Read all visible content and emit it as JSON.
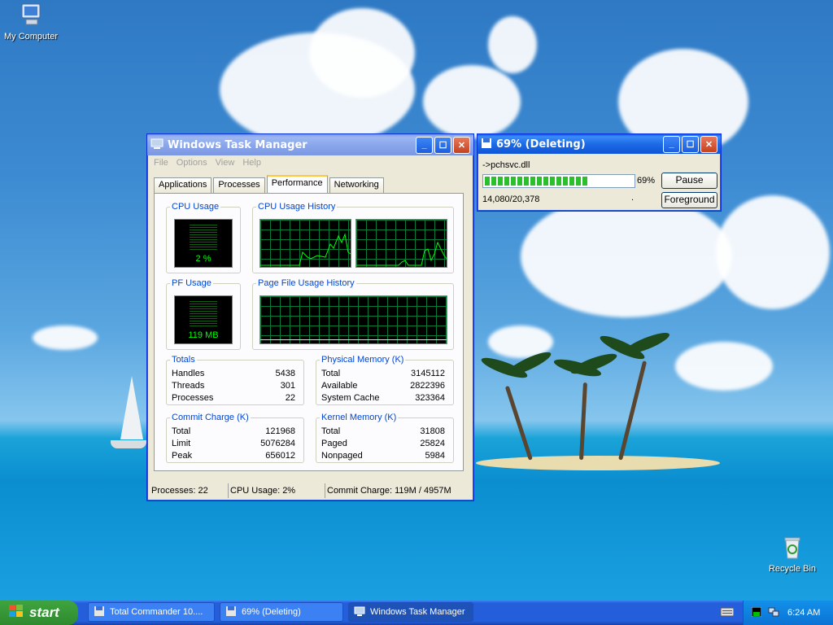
{
  "desktop": {
    "icons": [
      {
        "label": "My Computer"
      },
      {
        "label": "Recycle Bin"
      }
    ]
  },
  "task_manager": {
    "title": "Windows Task Manager",
    "menu": [
      "File",
      "Options",
      "View",
      "Help"
    ],
    "tabs": [
      "Applications",
      "Processes",
      "Performance",
      "Networking"
    ],
    "active_tab": "Performance",
    "cpu_usage": {
      "label": "CPU Usage",
      "value_text": "2 %"
    },
    "cpu_history": {
      "label": "CPU Usage History"
    },
    "pf_usage": {
      "label": "PF Usage",
      "value_text": "119 MB"
    },
    "pf_history": {
      "label": "Page File Usage History"
    },
    "totals": {
      "label": "Totals",
      "rows": [
        {
          "k": "Handles",
          "v": "5438"
        },
        {
          "k": "Threads",
          "v": "301"
        },
        {
          "k": "Processes",
          "v": "22"
        }
      ]
    },
    "physical_memory": {
      "label": "Physical Memory (K)",
      "rows": [
        {
          "k": "Total",
          "v": "3145112"
        },
        {
          "k": "Available",
          "v": "2822396"
        },
        {
          "k": "System Cache",
          "v": "323364"
        }
      ]
    },
    "commit_charge": {
      "label": "Commit Charge (K)",
      "rows": [
        {
          "k": "Total",
          "v": "121968"
        },
        {
          "k": "Limit",
          "v": "5076284"
        },
        {
          "k": "Peak",
          "v": "656012"
        }
      ]
    },
    "kernel_memory": {
      "label": "Kernel Memory (K)",
      "rows": [
        {
          "k": "Total",
          "v": "31808"
        },
        {
          "k": "Paged",
          "v": "25824"
        },
        {
          "k": "Nonpaged",
          "v": "5984"
        }
      ]
    },
    "status": {
      "processes": "Processes: 22",
      "cpu": "CPU Usage: 2%",
      "commit": "Commit Charge: 119M / 4957M"
    }
  },
  "delete_dialog": {
    "title": "69%  (Deleting)",
    "file": "->pchsvc.dll",
    "progress_percent": 69,
    "progress_text": "69%",
    "count": "14,080/20,378",
    "dot": ".",
    "pause_label": "Pause",
    "foreground_label": "Foreground"
  },
  "taskbar": {
    "start_label": "start",
    "tasks": [
      {
        "label": "Total Commander 10...."
      },
      {
        "label": "69%  (Deleting)"
      },
      {
        "label": "Windows Task Manager"
      }
    ],
    "clock": "6:24 AM"
  },
  "colors": {
    "xp_title_blue": "#0a5ce6",
    "progress_green": "#2bbf2b",
    "group_title_blue": "#0046d5",
    "meter_green": "#00ff00"
  }
}
